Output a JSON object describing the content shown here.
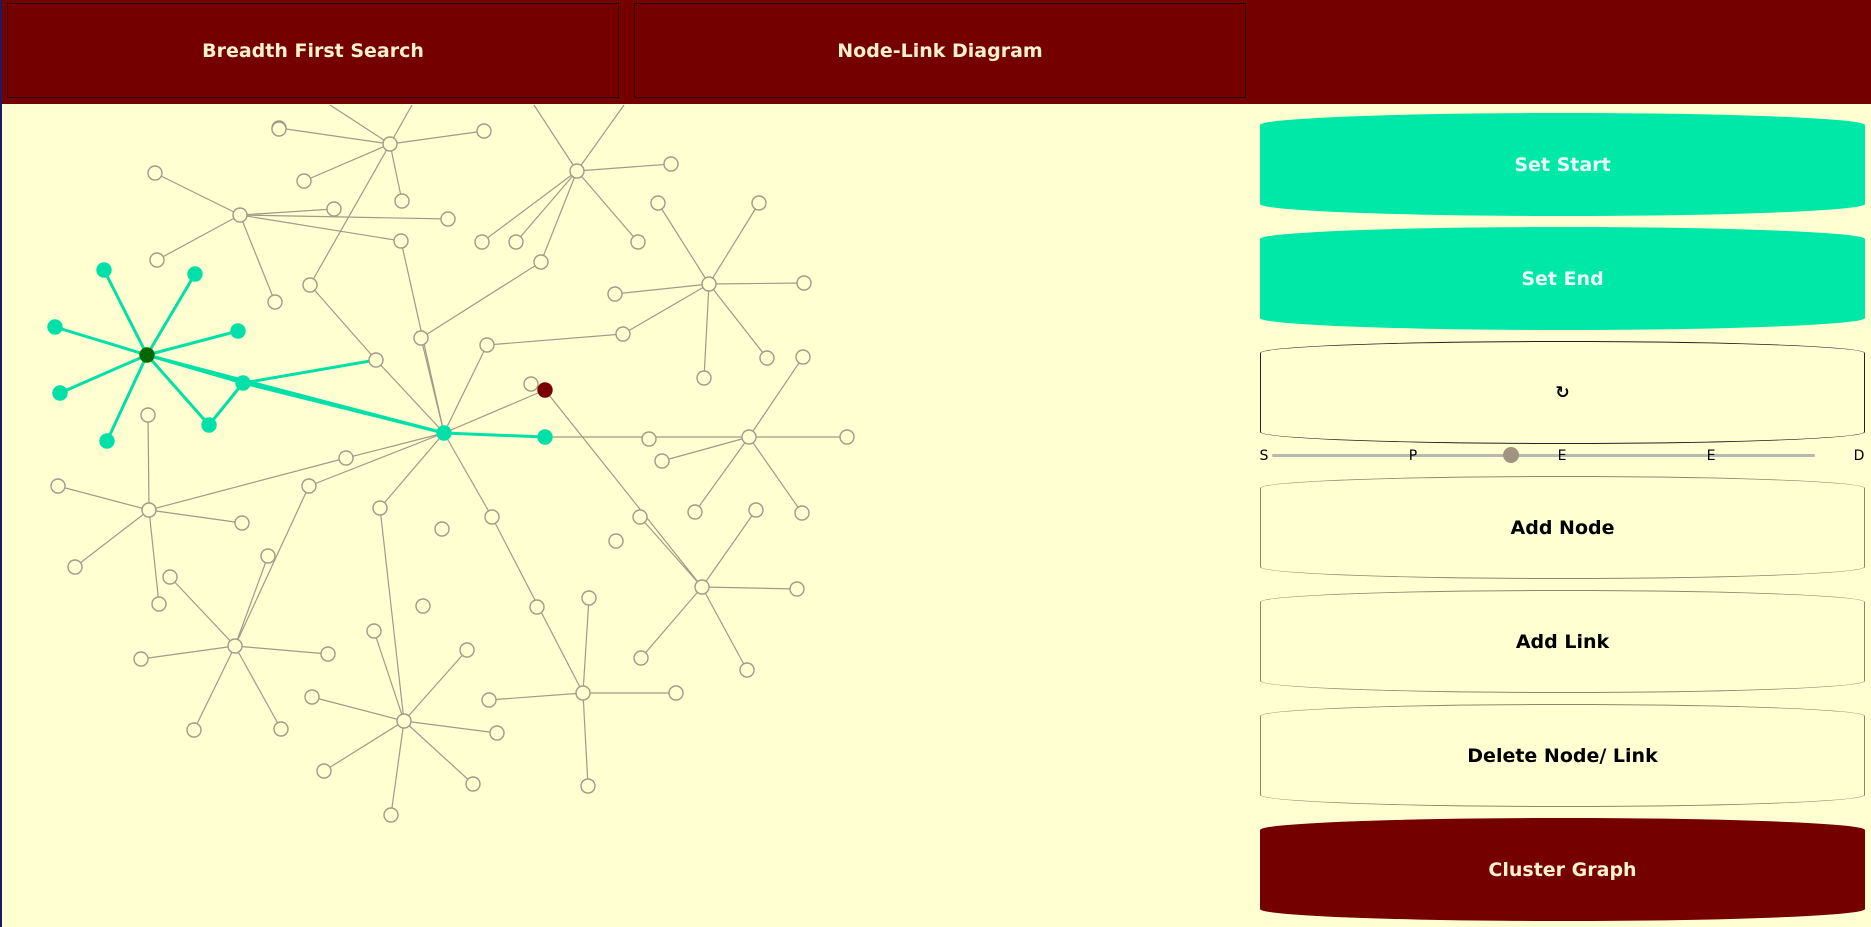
{
  "header": {
    "tab_algorithm": "Breadth First Search",
    "tab_view": "Node-Link Diagram"
  },
  "buttons": {
    "set_start": "Set Start",
    "set_end": "Set End",
    "reset": "↻",
    "add_node": "Add Node",
    "add_link": "Add Link",
    "delete": "Delete Node/ Link",
    "cluster": "Cluster Graph"
  },
  "speed_slider": {
    "ticks": [
      "S",
      "P",
      "E",
      "E",
      "D"
    ],
    "value": 0.44
  },
  "graph_state": {
    "start_node": "dark-green",
    "end_node": "dark-red",
    "visited_color": "#00e0a8",
    "start_color": "#006800",
    "end_color": "#7a0000",
    "edge_color": "#a09a88",
    "node_fill": "#ffffd2"
  }
}
